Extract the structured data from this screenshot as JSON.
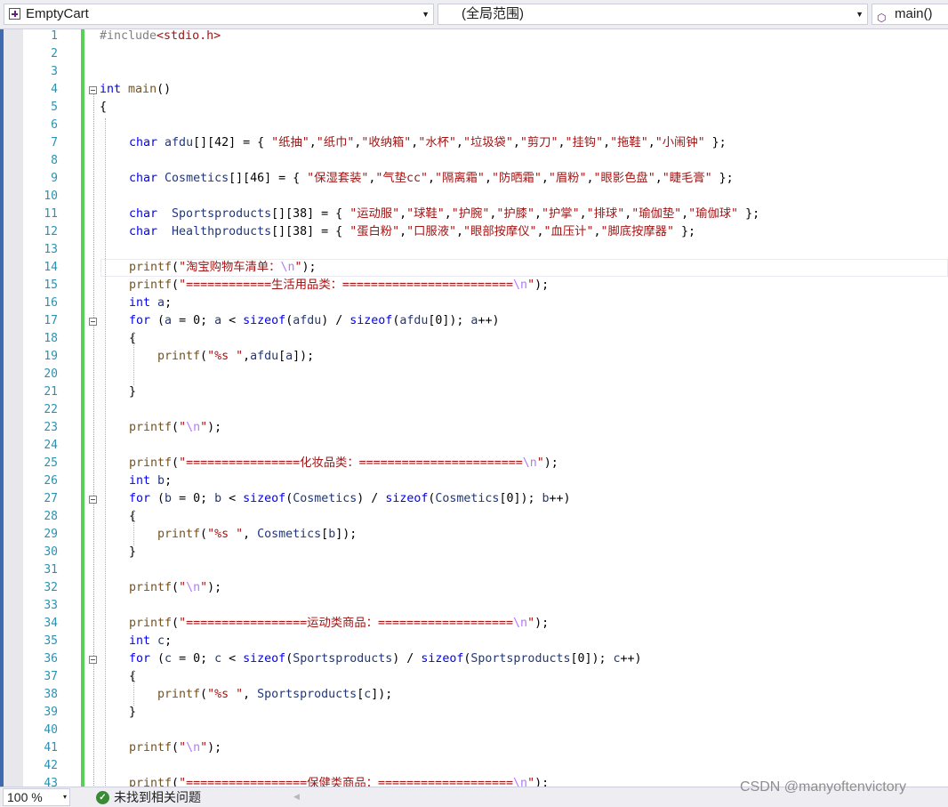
{
  "navbar": {
    "project": "EmptyCart",
    "scope": "(全局范围)",
    "member": "main()",
    "dropdown_glyph": "▼",
    "project_icon": "cpp-project-icon",
    "member_icon": "cube-icon"
  },
  "editor": {
    "colors": {
      "keyword": "#0000ff",
      "string": "#a31515",
      "escape": "#b776fb",
      "function": "#74531f",
      "variable": "#1f377f",
      "preprocessor": "#808080",
      "line_number": "#2b91af",
      "plain": "#000000"
    },
    "lines": [
      {
        "n": "1",
        "fold": false,
        "i": 0,
        "t": [
          {
            "s": "#include",
            "c": "preprocessor"
          },
          {
            "s": "<stdio.h>",
            "c": "string"
          }
        ]
      },
      {
        "n": "2",
        "fold": false,
        "i": 0,
        "t": []
      },
      {
        "n": "3",
        "fold": false,
        "i": 0,
        "t": []
      },
      {
        "n": "4",
        "fold": true,
        "i": 0,
        "t": [
          {
            "s": "int",
            "c": "keyword"
          },
          {
            "s": " "
          },
          {
            "s": "main",
            "c": "function"
          },
          {
            "s": "()"
          }
        ]
      },
      {
        "n": "5",
        "fold": false,
        "i": 0,
        "t": [
          {
            "s": "{"
          }
        ]
      },
      {
        "n": "6",
        "fold": false,
        "i": 0,
        "t": []
      },
      {
        "n": "7",
        "fold": false,
        "i": 1,
        "t": [
          {
            "s": "char",
            "c": "keyword"
          },
          {
            "s": " "
          },
          {
            "s": "afdu",
            "c": "variable"
          },
          {
            "s": "[][42] = { "
          },
          {
            "s": "\"纸抽\"",
            "c": "string"
          },
          {
            "s": ","
          },
          {
            "s": "\"纸巾\"",
            "c": "string"
          },
          {
            "s": ","
          },
          {
            "s": "\"收纳箱\"",
            "c": "string"
          },
          {
            "s": ","
          },
          {
            "s": "\"水杯\"",
            "c": "string"
          },
          {
            "s": ","
          },
          {
            "s": "\"垃圾袋\"",
            "c": "string"
          },
          {
            "s": ","
          },
          {
            "s": "\"剪刀\"",
            "c": "string"
          },
          {
            "s": ","
          },
          {
            "s": "\"挂钩\"",
            "c": "string"
          },
          {
            "s": ","
          },
          {
            "s": "\"拖鞋\"",
            "c": "string"
          },
          {
            "s": ","
          },
          {
            "s": "\"小闹钟\"",
            "c": "string"
          },
          {
            "s": " };"
          }
        ]
      },
      {
        "n": "8",
        "fold": false,
        "i": 0,
        "t": []
      },
      {
        "n": "9",
        "fold": false,
        "i": 1,
        "t": [
          {
            "s": "char",
            "c": "keyword"
          },
          {
            "s": " "
          },
          {
            "s": "Cosmetics",
            "c": "variable"
          },
          {
            "s": "[][46] = { "
          },
          {
            "s": "\"保湿套装\"",
            "c": "string"
          },
          {
            "s": ","
          },
          {
            "s": "\"气垫cc\"",
            "c": "string"
          },
          {
            "s": ","
          },
          {
            "s": "\"隔离霜\"",
            "c": "string"
          },
          {
            "s": ","
          },
          {
            "s": "\"防晒霜\"",
            "c": "string"
          },
          {
            "s": ","
          },
          {
            "s": "\"眉粉\"",
            "c": "string"
          },
          {
            "s": ","
          },
          {
            "s": "\"眼影色盘\"",
            "c": "string"
          },
          {
            "s": ","
          },
          {
            "s": "\"睫毛膏\"",
            "c": "string"
          },
          {
            "s": " };"
          }
        ]
      },
      {
        "n": "10",
        "fold": false,
        "i": 0,
        "t": []
      },
      {
        "n": "11",
        "fold": false,
        "i": 1,
        "t": [
          {
            "s": "char",
            "c": "keyword"
          },
          {
            "s": "  "
          },
          {
            "s": "Sportsproducts",
            "c": "variable"
          },
          {
            "s": "[][38] = { "
          },
          {
            "s": "\"运动服\"",
            "c": "string"
          },
          {
            "s": ","
          },
          {
            "s": "\"球鞋\"",
            "c": "string"
          },
          {
            "s": ","
          },
          {
            "s": "\"护腕\"",
            "c": "string"
          },
          {
            "s": ","
          },
          {
            "s": "\"护膝\"",
            "c": "string"
          },
          {
            "s": ","
          },
          {
            "s": "\"护掌\"",
            "c": "string"
          },
          {
            "s": ","
          },
          {
            "s": "\"排球\"",
            "c": "string"
          },
          {
            "s": ","
          },
          {
            "s": "\"瑜伽垫\"",
            "c": "string"
          },
          {
            "s": ","
          },
          {
            "s": "\"瑜伽球\"",
            "c": "string"
          },
          {
            "s": " };"
          }
        ]
      },
      {
        "n": "12",
        "fold": false,
        "i": 1,
        "t": [
          {
            "s": "char",
            "c": "keyword"
          },
          {
            "s": "  "
          },
          {
            "s": "Healthproducts",
            "c": "variable"
          },
          {
            "s": "[][38] = { "
          },
          {
            "s": "\"蛋白粉\"",
            "c": "string"
          },
          {
            "s": ","
          },
          {
            "s": "\"口服液\"",
            "c": "string"
          },
          {
            "s": ","
          },
          {
            "s": "\"眼部按摩仪\"",
            "c": "string"
          },
          {
            "s": ","
          },
          {
            "s": "\"血压计\"",
            "c": "string"
          },
          {
            "s": ","
          },
          {
            "s": "\"脚底按摩器\"",
            "c": "string"
          },
          {
            "s": " };"
          }
        ]
      },
      {
        "n": "13",
        "fold": false,
        "i": 0,
        "t": []
      },
      {
        "n": "14",
        "fold": false,
        "i": 1,
        "t": [
          {
            "s": "printf",
            "c": "function"
          },
          {
            "s": "("
          },
          {
            "s": "\"淘宝购物车清单：",
            "c": "string"
          },
          {
            "s": "\\n",
            "c": "escape"
          },
          {
            "s": "\"",
            "c": "string"
          },
          {
            "s": ");"
          }
        ]
      },
      {
        "n": "15",
        "fold": false,
        "i": 1,
        "t": [
          {
            "s": "printf",
            "c": "function"
          },
          {
            "s": "("
          },
          {
            "s": "\"============生活用品类：========================",
            "c": "string"
          },
          {
            "s": "\\n",
            "c": "escape"
          },
          {
            "s": "\"",
            "c": "string"
          },
          {
            "s": ");"
          }
        ]
      },
      {
        "n": "16",
        "fold": false,
        "i": 1,
        "t": [
          {
            "s": "int",
            "c": "keyword"
          },
          {
            "s": " "
          },
          {
            "s": "a",
            "c": "variable"
          },
          {
            "s": ";"
          }
        ]
      },
      {
        "n": "17",
        "fold": true,
        "i": 1,
        "t": [
          {
            "s": "for",
            "c": "keyword"
          },
          {
            "s": " ("
          },
          {
            "s": "a",
            "c": "variable"
          },
          {
            "s": " = 0; "
          },
          {
            "s": "a",
            "c": "variable"
          },
          {
            "s": " < "
          },
          {
            "s": "sizeof",
            "c": "keyword"
          },
          {
            "s": "("
          },
          {
            "s": "afdu",
            "c": "variable"
          },
          {
            "s": ") / "
          },
          {
            "s": "sizeof",
            "c": "keyword"
          },
          {
            "s": "("
          },
          {
            "s": "afdu",
            "c": "variable"
          },
          {
            "s": "[0]); "
          },
          {
            "s": "a",
            "c": "variable"
          },
          {
            "s": "++)"
          }
        ]
      },
      {
        "n": "18",
        "fold": false,
        "i": 1,
        "t": [
          {
            "s": "{"
          }
        ]
      },
      {
        "n": "19",
        "fold": false,
        "i": 2,
        "t": [
          {
            "s": "printf",
            "c": "function"
          },
          {
            "s": "("
          },
          {
            "s": "\"%s \"",
            "c": "string"
          },
          {
            "s": ","
          },
          {
            "s": "afdu",
            "c": "variable"
          },
          {
            "s": "["
          },
          {
            "s": "a",
            "c": "variable"
          },
          {
            "s": "]);"
          }
        ]
      },
      {
        "n": "20",
        "fold": false,
        "i": 0,
        "t": []
      },
      {
        "n": "21",
        "fold": false,
        "i": 1,
        "t": [
          {
            "s": "}"
          }
        ]
      },
      {
        "n": "22",
        "fold": false,
        "i": 0,
        "t": []
      },
      {
        "n": "23",
        "fold": false,
        "i": 1,
        "t": [
          {
            "s": "printf",
            "c": "function"
          },
          {
            "s": "("
          },
          {
            "s": "\"",
            "c": "string"
          },
          {
            "s": "\\n",
            "c": "escape"
          },
          {
            "s": "\"",
            "c": "string"
          },
          {
            "s": ");"
          }
        ]
      },
      {
        "n": "24",
        "fold": false,
        "i": 0,
        "t": []
      },
      {
        "n": "25",
        "fold": false,
        "i": 1,
        "t": [
          {
            "s": "printf",
            "c": "function"
          },
          {
            "s": "("
          },
          {
            "s": "\"================化妆品类：=======================",
            "c": "string"
          },
          {
            "s": "\\n",
            "c": "escape"
          },
          {
            "s": "\"",
            "c": "string"
          },
          {
            "s": ");"
          }
        ]
      },
      {
        "n": "26",
        "fold": false,
        "i": 1,
        "t": [
          {
            "s": "int",
            "c": "keyword"
          },
          {
            "s": " "
          },
          {
            "s": "b",
            "c": "variable"
          },
          {
            "s": ";"
          }
        ]
      },
      {
        "n": "27",
        "fold": true,
        "i": 1,
        "t": [
          {
            "s": "for",
            "c": "keyword"
          },
          {
            "s": " ("
          },
          {
            "s": "b",
            "c": "variable"
          },
          {
            "s": " = 0; "
          },
          {
            "s": "b",
            "c": "variable"
          },
          {
            "s": " < "
          },
          {
            "s": "sizeof",
            "c": "keyword"
          },
          {
            "s": "("
          },
          {
            "s": "Cosmetics",
            "c": "variable"
          },
          {
            "s": ") / "
          },
          {
            "s": "sizeof",
            "c": "keyword"
          },
          {
            "s": "("
          },
          {
            "s": "Cosmetics",
            "c": "variable"
          },
          {
            "s": "[0]); "
          },
          {
            "s": "b",
            "c": "variable"
          },
          {
            "s": "++)"
          }
        ]
      },
      {
        "n": "28",
        "fold": false,
        "i": 1,
        "t": [
          {
            "s": "{"
          }
        ]
      },
      {
        "n": "29",
        "fold": false,
        "i": 2,
        "t": [
          {
            "s": "printf",
            "c": "function"
          },
          {
            "s": "("
          },
          {
            "s": "\"%s \"",
            "c": "string"
          },
          {
            "s": ", "
          },
          {
            "s": "Cosmetics",
            "c": "variable"
          },
          {
            "s": "["
          },
          {
            "s": "b",
            "c": "variable"
          },
          {
            "s": "]);"
          }
        ]
      },
      {
        "n": "30",
        "fold": false,
        "i": 1,
        "t": [
          {
            "s": "}"
          }
        ]
      },
      {
        "n": "31",
        "fold": false,
        "i": 0,
        "t": []
      },
      {
        "n": "32",
        "fold": false,
        "i": 1,
        "t": [
          {
            "s": "printf",
            "c": "function"
          },
          {
            "s": "("
          },
          {
            "s": "\"",
            "c": "string"
          },
          {
            "s": "\\n",
            "c": "escape"
          },
          {
            "s": "\"",
            "c": "string"
          },
          {
            "s": ");"
          }
        ]
      },
      {
        "n": "33",
        "fold": false,
        "i": 0,
        "t": []
      },
      {
        "n": "34",
        "fold": false,
        "i": 1,
        "t": [
          {
            "s": "printf",
            "c": "function"
          },
          {
            "s": "("
          },
          {
            "s": "\"=================运动类商品：===================",
            "c": "string"
          },
          {
            "s": "\\n",
            "c": "escape"
          },
          {
            "s": "\"",
            "c": "string"
          },
          {
            "s": ");"
          }
        ]
      },
      {
        "n": "35",
        "fold": false,
        "i": 1,
        "t": [
          {
            "s": "int",
            "c": "keyword"
          },
          {
            "s": " "
          },
          {
            "s": "c",
            "c": "variable"
          },
          {
            "s": ";"
          }
        ]
      },
      {
        "n": "36",
        "fold": true,
        "i": 1,
        "t": [
          {
            "s": "for",
            "c": "keyword"
          },
          {
            "s": " ("
          },
          {
            "s": "c",
            "c": "variable"
          },
          {
            "s": " = 0; "
          },
          {
            "s": "c",
            "c": "variable"
          },
          {
            "s": " < "
          },
          {
            "s": "sizeof",
            "c": "keyword"
          },
          {
            "s": "("
          },
          {
            "s": "Sportsproducts",
            "c": "variable"
          },
          {
            "s": ") / "
          },
          {
            "s": "sizeof",
            "c": "keyword"
          },
          {
            "s": "("
          },
          {
            "s": "Sportsproducts",
            "c": "variable"
          },
          {
            "s": "[0]); "
          },
          {
            "s": "c",
            "c": "variable"
          },
          {
            "s": "++)"
          }
        ]
      },
      {
        "n": "37",
        "fold": false,
        "i": 1,
        "t": [
          {
            "s": "{"
          }
        ]
      },
      {
        "n": "38",
        "fold": false,
        "i": 2,
        "t": [
          {
            "s": "printf",
            "c": "function"
          },
          {
            "s": "("
          },
          {
            "s": "\"%s \"",
            "c": "string"
          },
          {
            "s": ", "
          },
          {
            "s": "Sportsproducts",
            "c": "variable"
          },
          {
            "s": "["
          },
          {
            "s": "c",
            "c": "variable"
          },
          {
            "s": "]);"
          }
        ]
      },
      {
        "n": "39",
        "fold": false,
        "i": 1,
        "t": [
          {
            "s": "}"
          }
        ]
      },
      {
        "n": "40",
        "fold": false,
        "i": 0,
        "t": []
      },
      {
        "n": "41",
        "fold": false,
        "i": 1,
        "t": [
          {
            "s": "printf",
            "c": "function"
          },
          {
            "s": "("
          },
          {
            "s": "\"",
            "c": "string"
          },
          {
            "s": "\\n",
            "c": "escape"
          },
          {
            "s": "\"",
            "c": "string"
          },
          {
            "s": ");"
          }
        ]
      },
      {
        "n": "42",
        "fold": false,
        "i": 0,
        "t": []
      },
      {
        "n": "43",
        "fold": false,
        "i": 1,
        "t": [
          {
            "s": "printf",
            "c": "function"
          },
          {
            "s": "("
          },
          {
            "s": "\"=================保健类商品：===================",
            "c": "string"
          },
          {
            "s": "\\n",
            "c": "escape"
          },
          {
            "s": "\"",
            "c": "string"
          },
          {
            "s": ");"
          }
        ]
      }
    ]
  },
  "statusbar": {
    "zoom": "100 %",
    "zoom_arrow": "▾",
    "issues_icon": "check-circle-icon",
    "issues_glyph": "✓",
    "issues_text": "未找到相关问题",
    "scroll_left_glyph": "◀"
  },
  "watermark": "CSDN @manyoftenvictory"
}
